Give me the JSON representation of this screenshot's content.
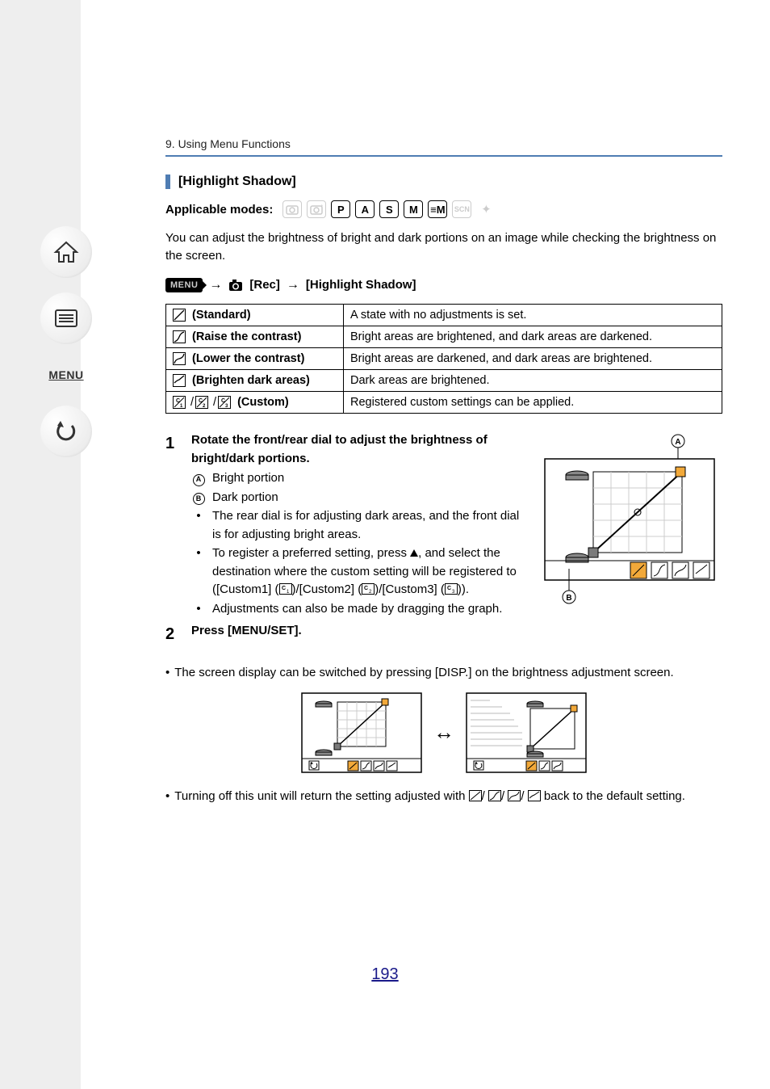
{
  "breadcrumb": "9. Using Menu Functions",
  "section_title": "[Highlight Shadow]",
  "applicable_label": "Applicable modes:",
  "modes": {
    "auto1_dim": true,
    "auto2_dim": true,
    "p": "P",
    "a": "A",
    "s": "S",
    "m": "M",
    "mv": "≡M",
    "scene_dim": true,
    "palette_dim": true
  },
  "intro": "You can adjust the brightness of bright and dark portions on an image while checking the brightness on the screen.",
  "menu_path": {
    "menu_label": "MENU",
    "rec": "[Rec]",
    "item": "[Highlight Shadow]"
  },
  "options": [
    {
      "name": "(Standard)",
      "desc": "A state with no adjustments is set."
    },
    {
      "name": "(Raise the contrast)",
      "desc": "Bright areas are brightened, and dark areas are darkened."
    },
    {
      "name": "(Lower the contrast)",
      "desc": "Bright areas are darkened, and dark areas are brightened."
    },
    {
      "name": "(Brighten dark areas)",
      "desc": "Dark areas are brightened."
    },
    {
      "name": "(Custom)",
      "desc": "Registered custom settings can be applied."
    }
  ],
  "step1": {
    "num": "1",
    "head": "Rotate the front/rear dial to adjust the brightness of bright/dark portions.",
    "a_label": "Bright portion",
    "b_label": "Dark portion",
    "bullet1": "The rear dial is for adjusting dark areas, and the front dial is for adjusting bright areas.",
    "bullet2a": "To register a preferred setting, press ",
    "bullet2b": ", and select the destination where the custom setting will be registered to ([Custom1] (",
    "bullet2c": ")/[Custom2] (",
    "bullet2d": ")/[Custom3] (",
    "bullet2e": ")).",
    "bullet3": "Adjustments can also be made by dragging the graph."
  },
  "step2": {
    "num": "2",
    "head": "Press [MENU/SET]."
  },
  "note1": "The screen display can be switched by pressing [DISP.] on the brightness adjustment screen.",
  "note2a": "Turning off this unit will return the setting adjusted with ",
  "note2b": " back to the default setting.",
  "page_number": "193",
  "icons": {
    "home": "home-icon",
    "list": "list-icon",
    "menu": "MENU",
    "back": "back-icon"
  },
  "diagram_labels": {
    "a": "A",
    "b": "B"
  }
}
